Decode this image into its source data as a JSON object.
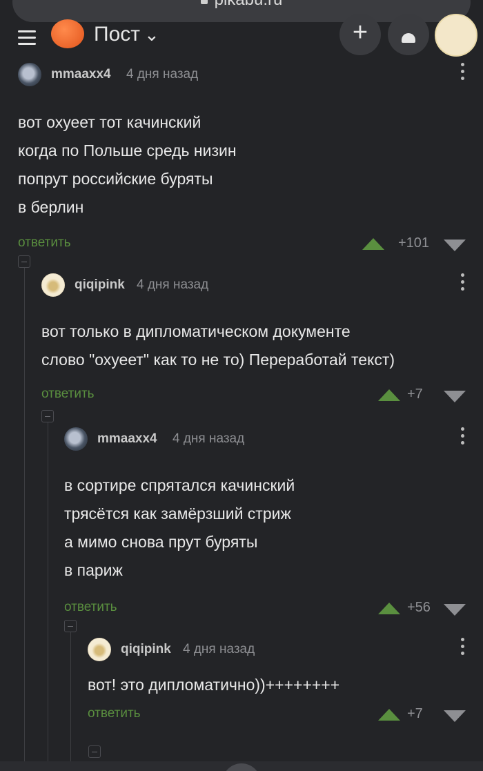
{
  "browser": {
    "url": "pikabu.ru"
  },
  "navbar": {
    "title": "Пост",
    "caret": "⌄",
    "plus": "+"
  },
  "comments": [
    {
      "user": "mmaaxx4",
      "time": "4 дня назад",
      "text": "вот охуеет тот качинский\nкогда по Польше средь низин\nпопрут российские буряты\nв берлин",
      "reply": "ответить",
      "score": "+101"
    },
    {
      "user": "qiqipink",
      "time": "4 дня назад",
      "text": "вот только в дипломатическом документе\nслово \"охуеет\" как то не то) Переработай текст)",
      "reply": "ответить",
      "score": "+7"
    },
    {
      "user": "mmaaxx4",
      "time": "4 дня назад",
      "text": "в сортире спрятался качинский\nтрясётся как замёрзший стриж\nа мимо снова прут буряты\nв париж",
      "reply": "ответить",
      "score": "+56"
    },
    {
      "user": "qiqipink",
      "time": "4 дня назад",
      "text": "вот! это дипломатично))++++++++",
      "reply": "ответить",
      "score": "+7"
    }
  ],
  "colors": {
    "background": "#232427",
    "accent_green": "#5a8f3f",
    "muted": "#8e8f93"
  }
}
